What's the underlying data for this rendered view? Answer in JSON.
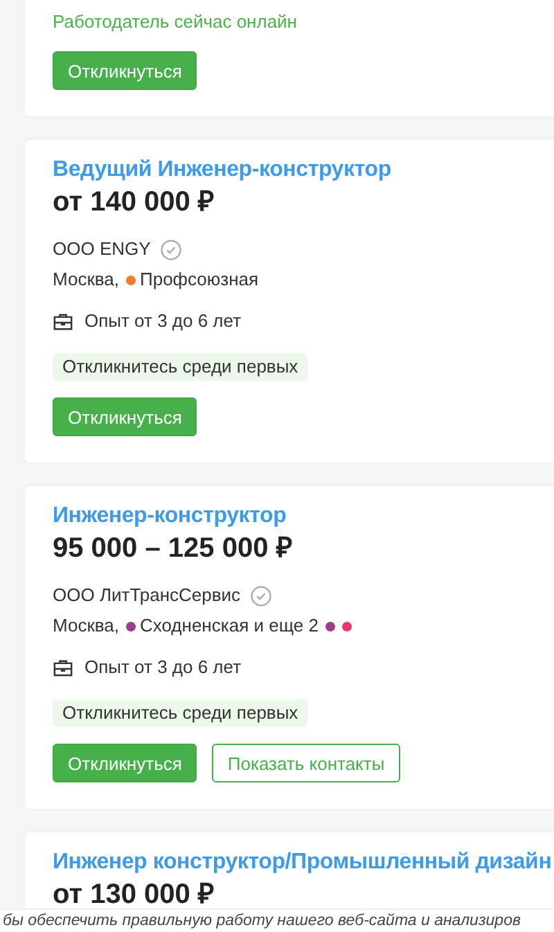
{
  "vacancies": [
    {
      "online_note": "Работодатель сейчас онлайн",
      "buttons": [
        {
          "label": "Откликнуться",
          "kind": "primary"
        }
      ]
    },
    {
      "title": "Ведущий Инженер-конструктор",
      "salary": "от 140 000 ₽",
      "company": "ООО ENGY",
      "verified": true,
      "location": {
        "city": "Москва,",
        "metro": "Профсоюзная",
        "color": "#f07d2e"
      },
      "experience": "Опыт от 3 до 6 лет",
      "badge": "Откликнитесь среди первых",
      "buttons": [
        {
          "label": "Откликнуться",
          "kind": "primary"
        }
      ]
    },
    {
      "title": "Инженер-конструктор",
      "salary": "95 000 – 125 000 ₽",
      "company": "ООО ЛитТрансСервис",
      "verified": true,
      "location": {
        "city": "Москва,",
        "metro": "Сходненская и еще 2",
        "color": "#9c3d8f",
        "more_dots": [
          {
            "color": "#9c3d8f"
          },
          {
            "color": "#e8386d"
          }
        ]
      },
      "experience": "Опыт от 3 до 6 лет",
      "badge": "Откликнитесь среди первых",
      "buttons": [
        {
          "label": "Откликнуться",
          "kind": "primary"
        },
        {
          "label": "Показать контакты",
          "kind": "outline"
        }
      ]
    },
    {
      "title": "Инженер конструктор/Промышленный дизайн",
      "salary": "от 130 000 ₽"
    }
  ],
  "cookie_banner": {
    "text": "бы обеспечить правильную работу нашего веб-сайта и анализиров"
  }
}
